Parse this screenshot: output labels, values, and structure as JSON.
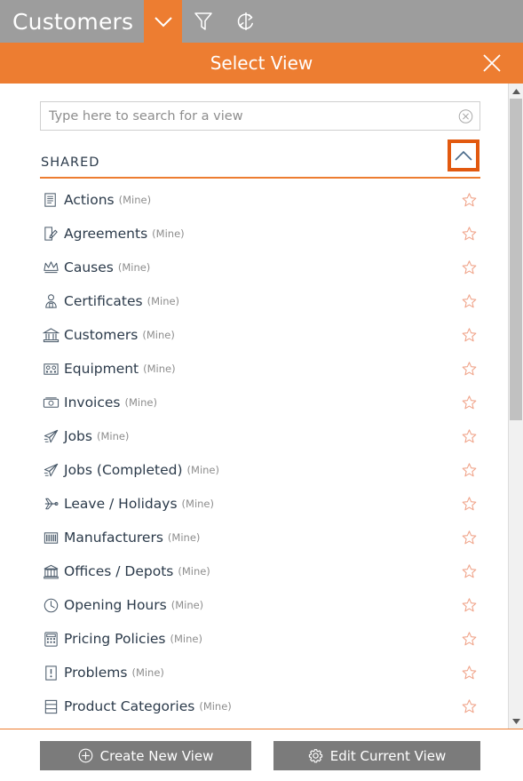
{
  "appbar": {
    "title": "Customers",
    "chevron_icon": "chevron-down-icon",
    "filter_icon": "filter-funnel-icon",
    "refresh_icon": "refresh-sync-icon",
    "background": "#9d9d9d",
    "accent": "#ED7D31"
  },
  "dialog": {
    "title": "Select View",
    "close_icon": "close-icon",
    "header_background": "#ED7D31"
  },
  "search": {
    "value": "",
    "placeholder": "Type here to search for a view",
    "clear_icon": "clear-circle-icon"
  },
  "group": {
    "label": "SHARED",
    "collapse_icon": "chevron-up-icon",
    "highlight_color": "#E2590F"
  },
  "views": [
    {
      "label": "Actions",
      "owner": "(Mine)",
      "icon": "document-lines-icon",
      "starred": false
    },
    {
      "label": "Agreements",
      "owner": "(Mine)",
      "icon": "document-pencil-icon",
      "starred": false
    },
    {
      "label": "Causes",
      "owner": "(Mine)",
      "icon": "crown-icon",
      "starred": false
    },
    {
      "label": "Certificates",
      "owner": "(Mine)",
      "icon": "person-badge-icon",
      "starred": false
    },
    {
      "label": "Customers",
      "owner": "(Mine)",
      "icon": "bank-building-icon",
      "starred": false
    },
    {
      "label": "Equipment",
      "owner": "(Mine)",
      "icon": "equipment-box-icon",
      "starred": false
    },
    {
      "label": "Invoices",
      "owner": "(Mine)",
      "icon": "money-note-icon",
      "starred": false
    },
    {
      "label": "Jobs",
      "owner": "(Mine)",
      "icon": "paper-plane-icon",
      "starred": false
    },
    {
      "label": "Jobs (Completed)",
      "owner": "(Mine)",
      "icon": "paper-plane-icon",
      "starred": false
    },
    {
      "label": "Leave / Holidays",
      "owner": "(Mine)",
      "icon": "airplane-icon",
      "starred": false
    },
    {
      "label": "Manufacturers",
      "owner": "(Mine)",
      "icon": "barcode-icon",
      "starred": false
    },
    {
      "label": "Offices / Depots",
      "owner": "(Mine)",
      "icon": "office-building-icon",
      "starred": false
    },
    {
      "label": "Opening Hours",
      "owner": "(Mine)",
      "icon": "clock-icon",
      "starred": false
    },
    {
      "label": "Pricing Policies",
      "owner": "(Mine)",
      "icon": "calculator-icon",
      "starred": false
    },
    {
      "label": "Problems",
      "owner": "(Mine)",
      "icon": "warning-page-icon",
      "starred": false
    },
    {
      "label": "Product Categories",
      "owner": "(Mine)",
      "icon": "stacked-box-icon",
      "starred": false
    }
  ],
  "scrollbar": {
    "up_icon": "scroll-up-arrow-icon",
    "down_icon": "scroll-down-arrow-icon",
    "thumb_color": "#c1c1c1"
  },
  "footer": {
    "create_label": "Create New View",
    "create_icon": "plus-circle-icon",
    "edit_label": "Edit Current View",
    "edit_icon": "gear-icon",
    "button_background": "#7b7b7b"
  },
  "colors": {
    "star_outline": "#F0A48A",
    "text_primary": "#2b3a4a",
    "text_muted": "#8d8d8d"
  }
}
